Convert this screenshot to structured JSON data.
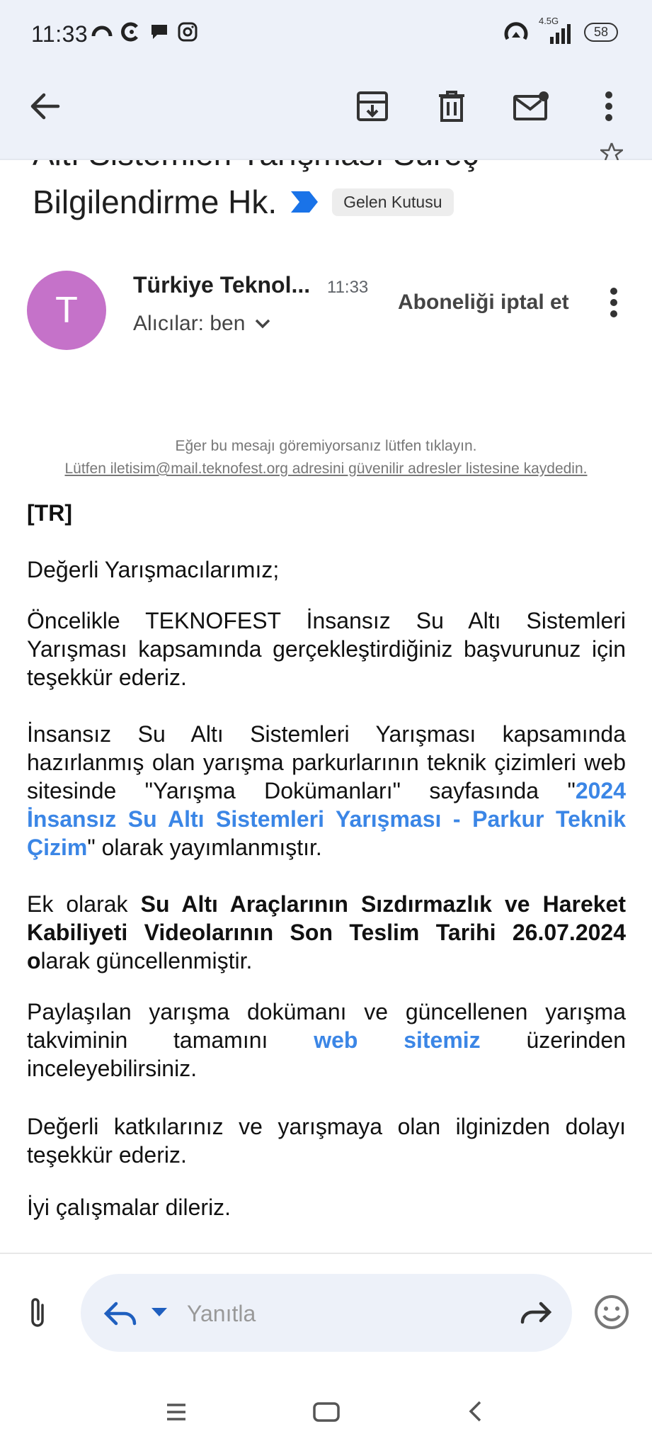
{
  "status_bar": {
    "time": "11:33",
    "network": "4.5G",
    "battery": "58"
  },
  "app_bar": {
    "back_icon": "arrow-back-icon",
    "actions": [
      "archive-icon",
      "trash-icon",
      "mark-unread-icon",
      "more-vert-icon"
    ]
  },
  "email": {
    "subject_line1": "Altı Sistemleri Yarışması Süreç",
    "subject_line2": "Bilgilendirme Hk.",
    "label": "Gelen Kutusu",
    "sender_initial": "T",
    "sender_name": "Türkiye Teknol...",
    "time": "11:33",
    "recipients": "Alıcılar: ben",
    "unsubscribe": "Aboneliği iptal et",
    "notice_line1": "Eğer bu mesajı göremiyorsanız lütfen tıklayın.",
    "notice_line2": "Lütfen iletisim@mail.teknofest.org adresini güvenilir adresler listesine kaydedin.",
    "body": {
      "lang_tag": "[TR]",
      "greeting": "Değerli Yarışmacılarımız;",
      "p1": "Öncelikle TEKNOFEST İnsansız Su Altı Sistemleri Yarışması kapsamında gerçekleştirdiğiniz başvurunuz için teşekkür ederiz.",
      "p2_start": "İnsansız Su Altı Sistemleri Yarışması kapsamında hazırlanmış olan yarışma parkurlarının teknik çizimleri web sitesinde \"Yarışma Dokümanları\" sayfasında \"",
      "p2_link": "2024 İnsansız Su Altı Sistemleri Yarışması - Parkur Teknik Çizim",
      "p2_end": "\" olarak yayımlanmıştır.",
      "p3_start": "Ek olarak ",
      "p3_bold": "Su Altı Araçlarının Sızdırmazlık ve Hareket Kabiliyeti Videolarının Son Teslim Tarihi 26.07.2024 o",
      "p3_end": "larak güncellenmiştir.",
      "p4_start": "Paylaşılan yarışma dokümanı ve güncellenen yarışma takviminin tamamını ",
      "p4_link": "web sitemiz",
      "p4_end": " üzerinden inceleyebilirsiniz.",
      "p5": "Değerli katkılarınız ve yarışmaya olan ilginizden dolayı teşekkür ederiz.",
      "closing": "İyi çalışmalar dileriz."
    }
  },
  "reply_bar": {
    "placeholder": "Yanıtla"
  }
}
